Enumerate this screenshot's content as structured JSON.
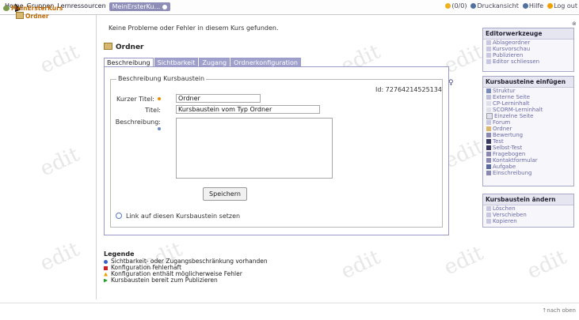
{
  "topbar": {
    "nav": [
      "Home",
      "Gruppen",
      "Lernressourcen"
    ],
    "active_tab": "MeinErsterKu...",
    "links": [
      {
        "label": "(0/0)",
        "icon": "star-icon",
        "color": "#f0b020"
      },
      {
        "label": "Druckansicht",
        "icon": "print-icon",
        "color": "#5070a0"
      },
      {
        "label": "Hilfe",
        "icon": "help-icon",
        "color": "#5070a0"
      },
      {
        "label": "Log out",
        "icon": "logout-icon",
        "color": "#f0a000"
      }
    ]
  },
  "tree": {
    "root": "MeinErsterKurs",
    "child": "Ordner"
  },
  "watermark": "edit",
  "main": {
    "message": "Keine Probleme oder Fehler in diesem Kurs gefunden.",
    "title": "Ordner",
    "tabs": [
      "Beschreibung",
      "Sichtbarkeit",
      "Zugang",
      "Ordnerkonfiguration"
    ],
    "fieldset_legend": "Beschreibung Kursbaustein",
    "id_text": "Id: 72764214525134",
    "short_title_label": "Kurzer Titel:",
    "short_title_value": "Ordner",
    "title_label": "Titel:",
    "title_value": "Kursbaustein vom Typ Ordner",
    "description_label": "Beschreibung:",
    "save_label": "Speichern",
    "link_label": "Link auf diesen Kursbaustein setzen"
  },
  "legend": {
    "title": "Legende",
    "items": [
      {
        "text": "Sichtbarkeit- oder Zugangsbeschränkung vorhanden",
        "color": "#3a63c6"
      },
      {
        "text": "Konfiguration fehlerhaft",
        "color": "#d02020"
      },
      {
        "text": "Konfiguration enthält möglicherweise Fehler",
        "color": "#f0a000"
      },
      {
        "text": "Kursbaustein bereit zum Publizieren",
        "color": "#20a020"
      }
    ]
  },
  "right": {
    "editor": {
      "title": "Editorwerkzeuge",
      "items": [
        "Ablageordner",
        "Kursvorschau",
        "Publizieren",
        "Editor schliessen"
      ]
    },
    "insert": {
      "title": "Kursbausteine einfügen",
      "items": [
        "Struktur",
        "Externe Seite",
        "CP-Lerninhalt",
        "SCORM-Lerninhalt",
        "Einzelne Seite",
        "Forum",
        "Ordner",
        "Bewertung",
        "Test",
        "Selbst-Test",
        "Fragebogen",
        "Kontaktformular",
        "Aufgabe",
        "Einschreibung"
      ]
    },
    "change": {
      "title": "Kursbaustein ändern",
      "items": [
        "Löschen",
        "Verschieben",
        "Kopieren"
      ]
    }
  },
  "footer": {
    "top_link": "nach oben"
  }
}
